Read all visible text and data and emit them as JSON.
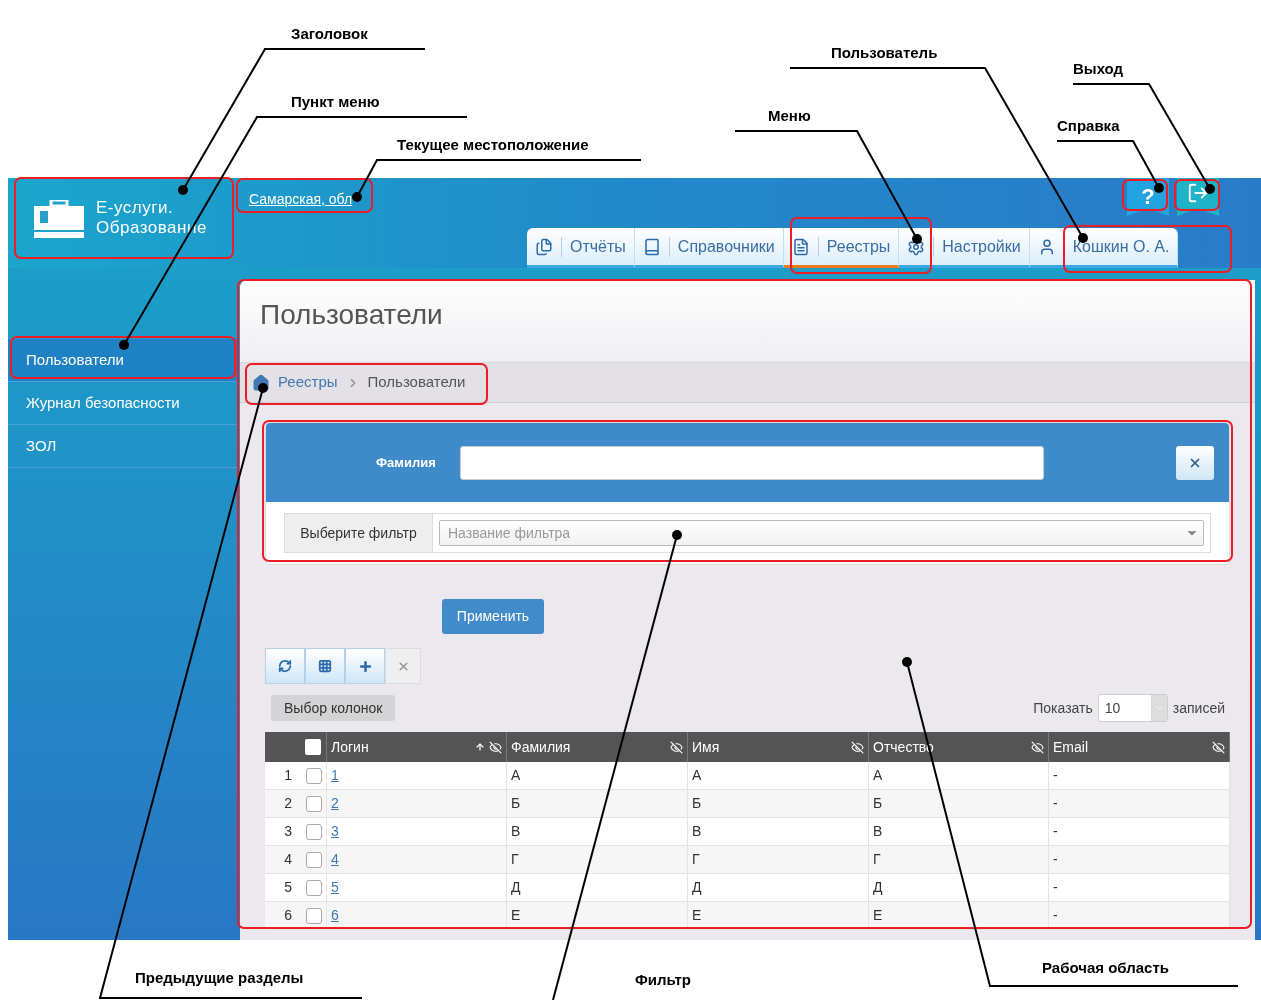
{
  "annotations": [
    {
      "label": "Заголовок"
    },
    {
      "label": "Пункт меню"
    },
    {
      "label": "Текущее местоположение"
    },
    {
      "label": "Меню"
    },
    {
      "label": "Пользователь"
    },
    {
      "label": "Выход"
    },
    {
      "label": "Справка"
    },
    {
      "label": "Предыдущие разделы"
    },
    {
      "label": "Фильтр"
    },
    {
      "label": "Рабочая область"
    }
  ],
  "header": {
    "app_title_line1": "Е-услуги.",
    "app_title_line2": "Образование",
    "location": "Самарская, обл",
    "help": "?"
  },
  "tabs": [
    {
      "label": "Отчёты",
      "selected": false
    },
    {
      "label": "Справочники",
      "selected": false
    },
    {
      "label": "Реестры",
      "selected": true
    },
    {
      "label": "Настройки",
      "selected": false
    },
    {
      "label": "Кошкин О. А.",
      "selected": false
    }
  ],
  "sidebar": {
    "items": [
      {
        "label": "Пользователи",
        "selected": true
      },
      {
        "label": "Журнал безопасности",
        "selected": false
      },
      {
        "label": "ЗОЛ",
        "selected": false
      }
    ]
  },
  "page_title": "Пользователи",
  "breadcrumb": [
    "Реестры",
    "Пользователи"
  ],
  "filter": {
    "field_label": "Фамилия",
    "select_addon": "Выберите фильтр",
    "select_placeholder": "Название фильтра"
  },
  "apply_button": "Применить",
  "columns_button": "Выбор колонок",
  "page_size": {
    "label_before": "Показать",
    "value": "10",
    "label_after": "записей"
  },
  "table": {
    "all_checked": false,
    "columns": [
      {
        "label": "Логин",
        "sorted": true
      },
      {
        "label": "Фамилия",
        "sorted": false
      },
      {
        "label": "Имя",
        "sorted": false
      },
      {
        "label": "Отчество",
        "sorted": false
      },
      {
        "label": "Email",
        "sorted": false
      }
    ],
    "rows": [
      {
        "number": "1",
        "checked": false,
        "cells": [
          "1",
          "А",
          "А",
          "А",
          "-"
        ]
      },
      {
        "number": "2",
        "checked": false,
        "cells": [
          "2",
          "Б",
          "Б",
          "Б",
          "-"
        ]
      },
      {
        "number": "3",
        "checked": false,
        "cells": [
          "3",
          "В",
          "В",
          "В",
          "-"
        ]
      },
      {
        "number": "4",
        "checked": false,
        "cells": [
          "4",
          "Г",
          "Г",
          "Г",
          "-"
        ]
      },
      {
        "number": "5",
        "checked": false,
        "cells": [
          "5",
          "Д",
          "Д",
          "Д",
          "-"
        ]
      },
      {
        "number": "6",
        "checked": false,
        "cells": [
          "6",
          "Е",
          "Е",
          "Е",
          "-"
        ]
      }
    ]
  }
}
